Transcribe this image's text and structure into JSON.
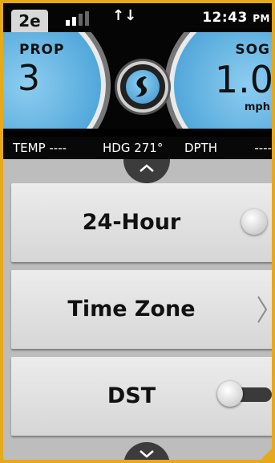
{
  "status_bar": {
    "badge": "2e",
    "signal_bars_active": 2,
    "signal_bars_total": 4,
    "transfer_icon": "data-transfer-icon",
    "time": "12:43",
    "ampm": "PM"
  },
  "gauges": {
    "prop_label": "PROP",
    "prop_value": "3",
    "sog_label": "SOG",
    "sog_value": "1.0",
    "sog_unit": "mph",
    "logo_icon": "brand-logo-icon"
  },
  "info": {
    "temp": "TEMP ----",
    "heading": "HDG 271°",
    "depth_label": "DPTH",
    "depth_value": "----"
  },
  "settings": {
    "items": [
      {
        "label": "24-Hour",
        "control": "radio",
        "checked": false
      },
      {
        "label": "Time Zone",
        "control": "chevron"
      },
      {
        "label": "DST",
        "control": "toggle",
        "on": false
      }
    ]
  },
  "colors": {
    "border_accent": "#e6a91a",
    "gauge_blue": "#4ba3d8",
    "row_gray": "#e0e0e0"
  }
}
